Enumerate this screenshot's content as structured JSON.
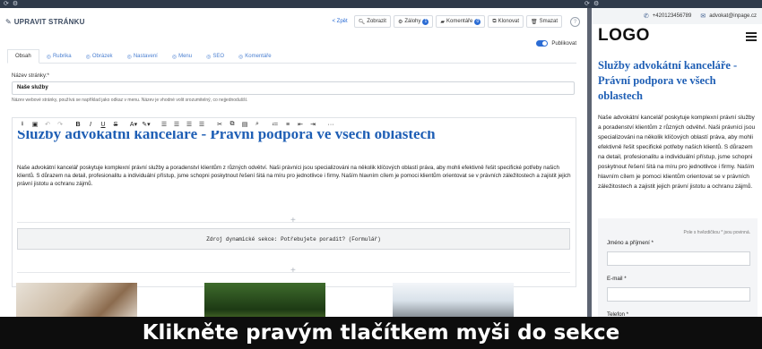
{
  "header": {
    "title": "UPRAVIT STRÁNKU",
    "back": "< Zpět",
    "buttons": [
      {
        "label": "Zobrazit",
        "icon": "search-icon"
      },
      {
        "label": "Zálohy",
        "badge": "1",
        "icon": "gear-icon"
      },
      {
        "label": "Komentáře",
        "badge": "0",
        "icon": "comment-icon"
      },
      {
        "label": "Klonovat",
        "icon": "copy-icon"
      },
      {
        "label": "Smazat",
        "icon": "trash-icon"
      }
    ],
    "help": "?",
    "publish_label": "Publikovat"
  },
  "tabs": [
    {
      "label": "Obsah"
    },
    {
      "label": "Rubrika"
    },
    {
      "label": "Obrázek"
    },
    {
      "label": "Nastavení"
    },
    {
      "label": "Menu"
    },
    {
      "label": "SEO"
    },
    {
      "label": "Komentáře"
    }
  ],
  "form": {
    "name_label": "Název stránky:*",
    "name_value": "Naše služby",
    "name_help": "Název webové stránky, používá se například jako odkaz v menu. Název je vhodné volit srozumitelný, co nejjednodušší."
  },
  "editor": {
    "heading": "Služby advokátní kanceláře - Právní podpora ve všech oblastech",
    "paragraph": "Naše advokátní kancelář poskytuje komplexní právní služby a poradenství klientům z různých odvětví. Naši právníci jsou specializováni na několik klíčových oblastí práva, aby mohli efektivně řešit specifické potřeby našich klientů. S důrazem na detail, profesionalitu a individuální přístup, jsme schopni poskytnout řešení šitá na míru pro jednotlivce i firmy. Naším hlavním cílem je pomoci klientům orientovat se v právních záležitostech a zajistit jejich právní jistotu a ochranu zájmů.",
    "dynamic_section": "Zdroj dynamické sekce: Potřebujete poradit? (Formulář)"
  },
  "preview": {
    "phone": "+420123456789",
    "email": "advokat@inpage.cz",
    "logo": "LOGO",
    "heading": "Služby advokátní kanceláře - Právní podpora ve všech oblastech",
    "paragraph": "Naše advokátní kancelář poskytuje komplexní právní služby a poradenství klientům z různých odvětví. Naši právníci jsou specializováni na několik klíčových oblastí práva, aby mohli efektivně řešit specifické potřeby našich klientů. S důrazem na detail, profesionalitu a individuální přístup, jsme schopni poskytnout řešení šitá na míru pro jednotlivce i firmy. Naším hlavním cílem je pomoci klientům orientovat se v právních záležitostech a zajistit jejich právní jistotu a ochranu zájmů.",
    "required_note": "Pole s hvězdičkou * jsou povinná.",
    "field_name": "Jméno a příjmení *",
    "field_email": "E-mail *",
    "field_phone": "Telefon *"
  },
  "caption": "Klikněte pravým tlačítkem myši do sekce"
}
